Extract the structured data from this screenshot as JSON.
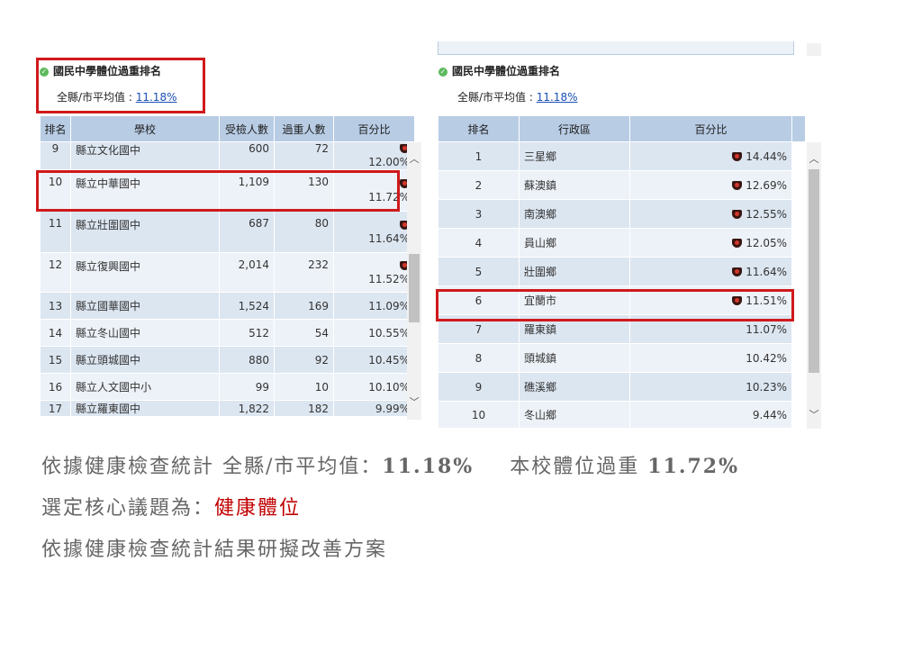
{
  "left_panel": {
    "title": "國民中學體位過重排名",
    "avg_label": "全縣/市平均值 : ",
    "avg_value": "11.18%",
    "headers": [
      "排名",
      "學校",
      "受檢人數",
      "過重人數",
      "百分比"
    ],
    "rows": [
      {
        "rank": "9",
        "name": "縣立文化國中",
        "examined": "600",
        "overweight": "72",
        "percent": "12.00%",
        "icon": true
      },
      {
        "rank": "10",
        "name": "縣立中華國中",
        "examined": "1,109",
        "overweight": "130",
        "percent": "11.72%",
        "icon": true
      },
      {
        "rank": "11",
        "name": "縣立壯圍國中",
        "examined": "687",
        "overweight": "80",
        "percent": "11.64%",
        "icon": true
      },
      {
        "rank": "12",
        "name": "縣立復興國中",
        "examined": "2,014",
        "overweight": "232",
        "percent": "11.52%",
        "icon": true
      },
      {
        "rank": "13",
        "name": "縣立國華國中",
        "examined": "1,524",
        "overweight": "169",
        "percent": "11.09%",
        "icon": false
      },
      {
        "rank": "14",
        "name": "縣立冬山國中",
        "examined": "512",
        "overweight": "54",
        "percent": "10.55%",
        "icon": false
      },
      {
        "rank": "15",
        "name": "縣立頭城國中",
        "examined": "880",
        "overweight": "92",
        "percent": "10.45%",
        "icon": false
      },
      {
        "rank": "16",
        "name": "縣立人文國中小",
        "examined": "99",
        "overweight": "10",
        "percent": "10.10%",
        "icon": false
      },
      {
        "rank": "17",
        "name": "縣立羅東國中",
        "examined": "1,822",
        "overweight": "182",
        "percent": "9.99%",
        "icon": false
      }
    ]
  },
  "right_panel": {
    "title": "國民中學體位過重排名",
    "avg_label": "全縣/市平均值 : ",
    "avg_value": "11.18%",
    "headers": [
      "排名",
      "行政區",
      "百分比"
    ],
    "rows": [
      {
        "rank": "1",
        "district": "三星鄉",
        "percent": "14.44%",
        "icon": true
      },
      {
        "rank": "2",
        "district": "蘇澳鎮",
        "percent": "12.69%",
        "icon": true
      },
      {
        "rank": "3",
        "district": "南澳鄉",
        "percent": "12.55%",
        "icon": true
      },
      {
        "rank": "4",
        "district": "員山鄉",
        "percent": "12.05%",
        "icon": true
      },
      {
        "rank": "5",
        "district": "壯圍鄉",
        "percent": "11.64%",
        "icon": true
      },
      {
        "rank": "6",
        "district": "宜蘭市",
        "percent": "11.51%",
        "icon": true
      },
      {
        "rank": "7",
        "district": "羅東鎮",
        "percent": "11.07%",
        "icon": false
      },
      {
        "rank": "8",
        "district": "頭城鎮",
        "percent": "10.42%",
        "icon": false
      },
      {
        "rank": "9",
        "district": "礁溪鄉",
        "percent": "10.23%",
        "icon": false
      },
      {
        "rank": "10",
        "district": "冬山鄉",
        "percent": "9.44%",
        "icon": false
      }
    ]
  },
  "caption": {
    "line1_a": "依據健康檢查統計 全縣/市平均值：",
    "line1_b": "11.18%",
    "line1_c": "本校體位過重 ",
    "line1_d": "11.72%",
    "line2_a": "選定核心議題為：",
    "line2_b": "健康體位",
    "line3": "依據健康檢查統計結果研擬改善方案"
  },
  "colors": {
    "highlight": "#d0191b",
    "header_bg": "#b8cce4",
    "caption_accent": "#c00000"
  }
}
